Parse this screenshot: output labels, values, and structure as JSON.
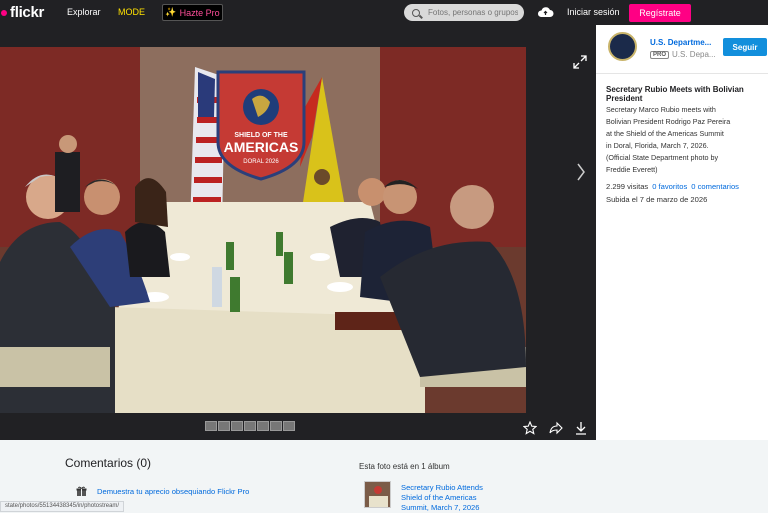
{
  "nav": {
    "logo": "flickr",
    "explore": "Explorar",
    "mode": "MODE",
    "pro_button": "Hazte Pro",
    "search_placeholder": "Fotos, personas o grupos",
    "login": "Iniciar sesión",
    "register": "Regístrate"
  },
  "owner": {
    "name": "U.S. Departme...",
    "pro_badge": "PRO",
    "sub_name": "U.S. Depa...",
    "follow": "Seguir"
  },
  "photo": {
    "title": "Secretary Rubio Meets with Bolivian President",
    "description": "Secretary Marco Rubio meets with Bolivian President Rodrigo Paz Pereira at the Shield of the Americas Summit in Doral, Florida, March 7, 2026. (Official State Department photo by Freddie Everett)",
    "views": "2.299 visitas",
    "favorites": "0 favoritos",
    "comments": "0 comentarios",
    "uploaded": "Subida el 7 de marzo de 2026",
    "banner_line1": "SHIELD OF THE",
    "banner_line2": "AMERICAS",
    "banner_line3": "DORAL 2026"
  },
  "bottom": {
    "comments_heading": "Comentarios (0)",
    "gift_link": "Demuestra tu aprecio obsequiando Flickr Pro",
    "album_heading": "Esta foto está en 1 álbum",
    "album_title": "Secretary Rubio Attends Shield of the Americas Summit, March 7, 2026"
  },
  "status_url": "state/photos/55134438345/in/photostream/",
  "colors": {
    "accent_pink": "#ff0084",
    "link_blue": "#006add",
    "follow_blue": "#128fdc",
    "nav_bg": "#212124"
  }
}
